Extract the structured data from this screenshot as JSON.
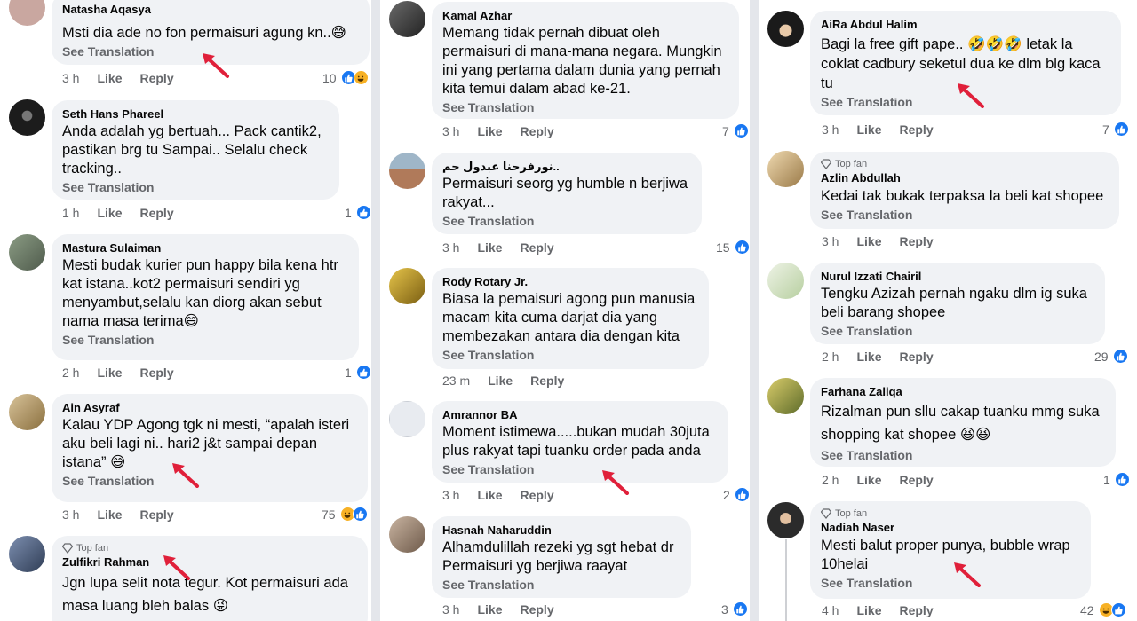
{
  "colors": {
    "bubble": "#f0f2f5",
    "meta": "#65676b",
    "like": "#1877f2",
    "haha": "#f7b125",
    "arrow": "#e0203a"
  },
  "labels": {
    "see_translation": "See Translation",
    "like": "Like",
    "reply": "Reply",
    "top_fan": "Top fan"
  },
  "columns": [
    {
      "comments": [
        {
          "name": "Natasha Aqasya",
          "text": "Msti dia ade no fon permaisuri agung kn..😅",
          "time": "3 h",
          "count": "10",
          "reactions": [
            "like",
            "haha"
          ],
          "avatar_color": "#c9a7a0"
        },
        {
          "name": "Seth Hans Phareel",
          "text": "Anda adalah yg bertuah... Pack cantik2, pastikan brg tu Sampai.. Selalu check tracking..",
          "time": "1 h",
          "count": "1",
          "reactions": [
            "like"
          ],
          "avatar_color": "#1c1c1c"
        },
        {
          "name": "Mastura Sulaiman",
          "text": "Mesti budak kurier pun happy bila kena htr kat istana..kot2 permaisuri sendiri yg menyambut,selalu kan diorg akan sebut nama masa terima😄",
          "time": "2 h",
          "count": "1",
          "reactions": [
            "like"
          ],
          "avatar_color": "#6f7d6a"
        },
        {
          "name": "Ain Asyraf",
          "text": "Kalau YDP Agong tgk ni mesti, “apalah isteri aku beli lagi ni.. hari2 j&t sampai depan istana” 😅",
          "time": "3 h",
          "count": "75",
          "reactions": [
            "haha",
            "like"
          ],
          "avatar_color": "#b59a66"
        },
        {
          "name": "Zulfikri Rahman",
          "top_fan": true,
          "text": "Jgn lupa selit nota tegur. Kot permaisuri ada masa luang bleh balas 😜",
          "avatar_color": "#4a5f7a"
        }
      ]
    },
    {
      "comments": [
        {
          "name": "Kamal Azhar",
          "text": "Memang tidak pernah dibuat oleh permaisuri di mana-mana negara. Mungkin ini yang pertama dalam dunia yang pernah kita temui dalam abad ke-21.",
          "time": "3 h",
          "count": "7",
          "reactions": [
            "like"
          ],
          "avatar_color": "#3a3a3a"
        },
        {
          "name": "نورفرحنا عبدول حم..",
          "text": "Permaisuri seorg yg humble n berjiwa rakyat...",
          "time": "3 h",
          "count": "15",
          "reactions": [
            "like"
          ],
          "avatar_color": "#b07a5a"
        },
        {
          "name": "Rody Rotary Jr.",
          "text": "Biasa la pemaisuri agong pun manusia macam kita cuma darjat dia yang membezakan antara dia dengan kita",
          "time": "23 m",
          "count": "",
          "reactions": [],
          "avatar_color": "#d8b23a"
        },
        {
          "name": "Amrannor BA",
          "text": "Moment istimewa.....bukan mudah 30juta plus rakyat tapi tuanku order pada anda",
          "time": "3 h",
          "count": "2",
          "reactions": [
            "like"
          ],
          "avatar_color": "#dfe3ea"
        },
        {
          "name": "Hasnah Naharuddin",
          "text": "Alhamdulillah rezeki yg sgt hebat dr Permaisuri yg berjiwa raayat",
          "time": "3 h",
          "count": "3",
          "reactions": [
            "like"
          ],
          "avatar_color": "#a08b7a"
        }
      ]
    },
    {
      "comments": [
        {
          "name": "AiRa Abdul Halim",
          "text": "Bagi la free gift pape.. 🤣🤣🤣 letak la coklat cadbury seketul dua ke dlm blg kaca tu",
          "time": "3 h",
          "count": "7",
          "reactions": [
            "like"
          ],
          "avatar_color": "#202020"
        },
        {
          "name": "Azlin Abdullah",
          "top_fan": true,
          "text": "Kedai tak bukak terpaksa la beli kat shopee",
          "time": "3 h",
          "count": "",
          "reactions": [],
          "avatar_color": "#c7a56f"
        },
        {
          "name": "Nurul Izzati Chairil",
          "text": "Tengku Azizah pernah ngaku dlm ig suka beli barang shopee",
          "time": "2 h",
          "count": "29",
          "reactions": [
            "like"
          ],
          "avatar_color": "#d9e6c9"
        },
        {
          "name": "Farhana Zaliqa",
          "text": "Rizalman pun sllu cakap tuanku mmg suka shopping kat shopee 😆😆",
          "time": "2 h",
          "count": "1",
          "reactions": [
            "like"
          ],
          "avatar_color": "#b3a23c"
        },
        {
          "name": "Nadiah Naser",
          "top_fan": true,
          "text": "Mesti balut proper punya, bubble wrap 10helai",
          "time": "4 h",
          "count": "42",
          "reactions": [
            "haha",
            "like"
          ],
          "avatar_color": "#2b2b2b"
        }
      ]
    }
  ]
}
